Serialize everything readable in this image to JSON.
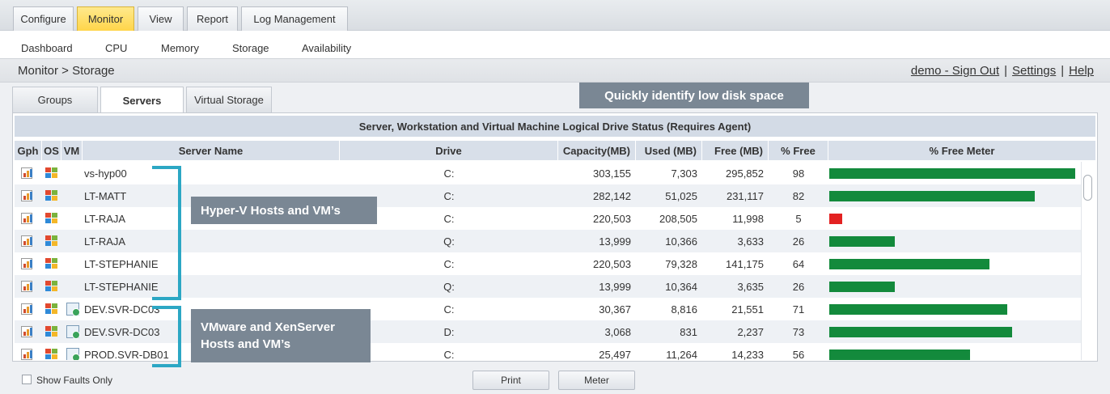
{
  "top_tabs": [
    {
      "label": "Configure"
    },
    {
      "label": "Monitor"
    },
    {
      "label": "View"
    },
    {
      "label": "Report"
    },
    {
      "label": "Log Management"
    }
  ],
  "sub_nav": [
    {
      "label": "Dashboard"
    },
    {
      "label": "CPU"
    },
    {
      "label": "Memory"
    },
    {
      "label": "Storage"
    },
    {
      "label": "Availability"
    }
  ],
  "breadcrumb": "Monitor > Storage",
  "user_links": {
    "signout": "demo - Sign Out",
    "separator": "|",
    "settings": "Settings",
    "help": "Help"
  },
  "panel_tabs": [
    {
      "label": "Groups"
    },
    {
      "label": "Servers"
    },
    {
      "label": "Virtual Storage"
    }
  ],
  "callouts": {
    "low_disk": "Quickly identify low disk space",
    "hyperv": "Hyper-V Hosts and VM’s",
    "vmware_line1": "VMware and XenServer",
    "vmware_line2": "Hosts and VM’s"
  },
  "table": {
    "caption": "Server, Workstation and Virtual Machine Logical Drive Status (Requires Agent)",
    "headers": {
      "gph": "Gph",
      "os": "OS",
      "vm": "VM",
      "server": "Server Name",
      "drive": "Drive",
      "capacity": "Capacity(MB)",
      "used": "Used (MB)",
      "free": "Free (MB)",
      "pct": "% Free",
      "meter": "% Free Meter"
    },
    "rows": [
      {
        "server": "vs-hyp00",
        "vm": false,
        "drive": "C:",
        "capacity": "303,155",
        "used": "7,303",
        "free": "295,852",
        "pct": "98",
        "pct_free": 98,
        "status": "ok"
      },
      {
        "server": "LT-MATT",
        "vm": false,
        "drive": "C:",
        "capacity": "282,142",
        "used": "51,025",
        "free": "231,117",
        "pct": "82",
        "pct_free": 82,
        "status": "ok"
      },
      {
        "server": "LT-RAJA",
        "vm": false,
        "drive": "C:",
        "capacity": "220,503",
        "used": "208,505",
        "free": "11,998",
        "pct": "5",
        "pct_free": 5,
        "status": "low"
      },
      {
        "server": "LT-RAJA",
        "vm": false,
        "drive": "Q:",
        "capacity": "13,999",
        "used": "10,366",
        "free": "3,633",
        "pct": "26",
        "pct_free": 26,
        "status": "ok"
      },
      {
        "server": "LT-STEPHANIE",
        "vm": false,
        "drive": "C:",
        "capacity": "220,503",
        "used": "79,328",
        "free": "141,175",
        "pct": "64",
        "pct_free": 64,
        "status": "ok"
      },
      {
        "server": "LT-STEPHANIE",
        "vm": false,
        "drive": "Q:",
        "capacity": "13,999",
        "used": "10,364",
        "free": "3,635",
        "pct": "26",
        "pct_free": 26,
        "status": "ok"
      },
      {
        "server": "DEV.SVR-DC03",
        "vm": true,
        "drive": "C:",
        "capacity": "30,367",
        "used": "8,816",
        "free": "21,551",
        "pct": "71",
        "pct_free": 71,
        "status": "ok"
      },
      {
        "server": "DEV.SVR-DC03",
        "vm": true,
        "drive": "D:",
        "capacity": "3,068",
        "used": "831",
        "free": "2,237",
        "pct": "73",
        "pct_free": 73,
        "status": "ok"
      },
      {
        "server": "PROD.SVR-DB01",
        "vm": true,
        "drive": "C:",
        "capacity": "25,497",
        "used": "11,264",
        "free": "14,233",
        "pct": "56",
        "pct_free": 56,
        "status": "ok"
      }
    ]
  },
  "footer": {
    "show_faults_label": "Show Faults Only",
    "print_label": "Print",
    "meter_label": "Meter"
  },
  "colors": {
    "meter_ok": "#138a3c",
    "meter_low": "#e32121",
    "active_tab": "#ffd54a",
    "callout_bg": "#7a8794",
    "bracket": "#2ca7c4"
  }
}
